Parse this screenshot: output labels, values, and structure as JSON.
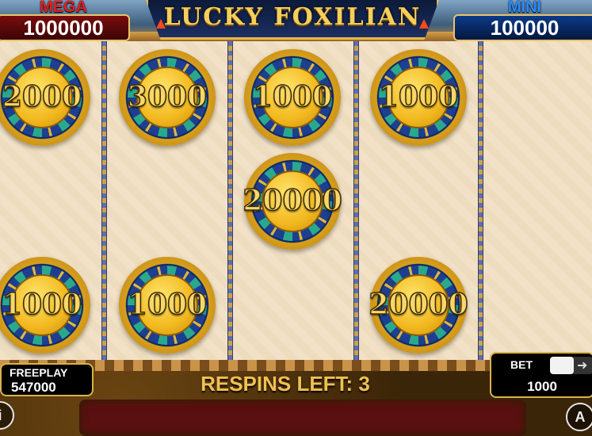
{
  "header": {
    "game_title": "LUCKY FOXILIAN",
    "jackpots": {
      "mega": {
        "label": "MEGA",
        "value": "1000000",
        "color": "#e02020"
      },
      "mini": {
        "label": "MINI",
        "value": "100000",
        "color": "#2b8cff"
      }
    }
  },
  "reels": {
    "coins": [
      {
        "reel": 1,
        "row": 1,
        "value": "2000"
      },
      {
        "reel": 2,
        "row": 1,
        "value": "3000"
      },
      {
        "reel": 3,
        "row": 1,
        "value": "1000"
      },
      {
        "reel": 4,
        "row": 1,
        "value": "1000"
      },
      {
        "reel": 3,
        "row": 2,
        "value": "20000"
      },
      {
        "reel": 1,
        "row": 3,
        "value": "1000"
      },
      {
        "reel": 2,
        "row": 3,
        "value": "1000"
      },
      {
        "reel": 4,
        "row": 3,
        "value": "20000"
      }
    ]
  },
  "footer": {
    "respins_text": "RESPINS LEFT: 3",
    "freeplay": {
      "label": "FREEPLAY",
      "value": "547000"
    },
    "bet": {
      "label": "BET",
      "value": "1000",
      "arrow_icon": "arrow-right-icon"
    },
    "info_button": {
      "label": "i",
      "icon": "info-icon"
    },
    "autoplay_button": {
      "label": "A",
      "icon": "autoplay-icon"
    }
  }
}
